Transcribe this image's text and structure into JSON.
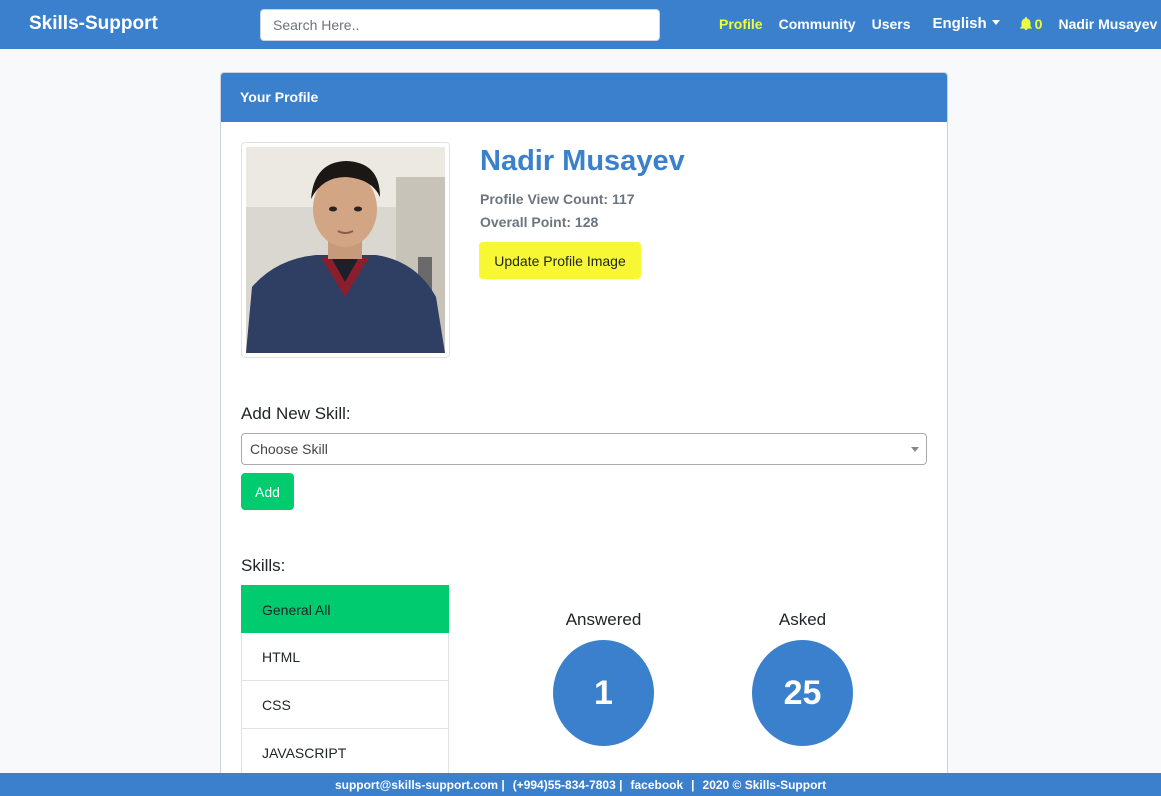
{
  "navbar": {
    "brand": "Skills-Support",
    "search_placeholder": "Search Here..",
    "links": {
      "profile": "Profile",
      "community": "Community",
      "users": "Users",
      "language": "English",
      "notifications_count": "0",
      "user": "Nadir Musayev"
    },
    "active_color": "#ebff3b"
  },
  "card": {
    "header": "Your Profile",
    "profile": {
      "name": "Nadir Musayev",
      "view_count": "Profile View Count: 117",
      "overall_point": "Overall Point: 128",
      "update_button": "Update Profile Image"
    },
    "add_skill": {
      "label": "Add New Skill:",
      "select_value": "Choose Skill",
      "add_button": "Add"
    },
    "skills": {
      "label": "Skills:",
      "items": [
        "General All",
        "HTML",
        "CSS",
        "JAVASCRIPT"
      ],
      "selected": "General All"
    },
    "stats": {
      "answered_label": "Answered",
      "answered_value": "1",
      "asked_label": "Asked",
      "asked_value": "25"
    }
  },
  "footer": {
    "email": "support@skills-support.com |",
    "phone": "(+994)55-834-7803 |",
    "facebook": "facebook",
    "separator": "|",
    "copyright": "2020 © Skills-Support"
  },
  "colors": {
    "primary": "#3b80cc",
    "accent_yellow": "#f7f733",
    "success_green": "#00cc6f"
  }
}
